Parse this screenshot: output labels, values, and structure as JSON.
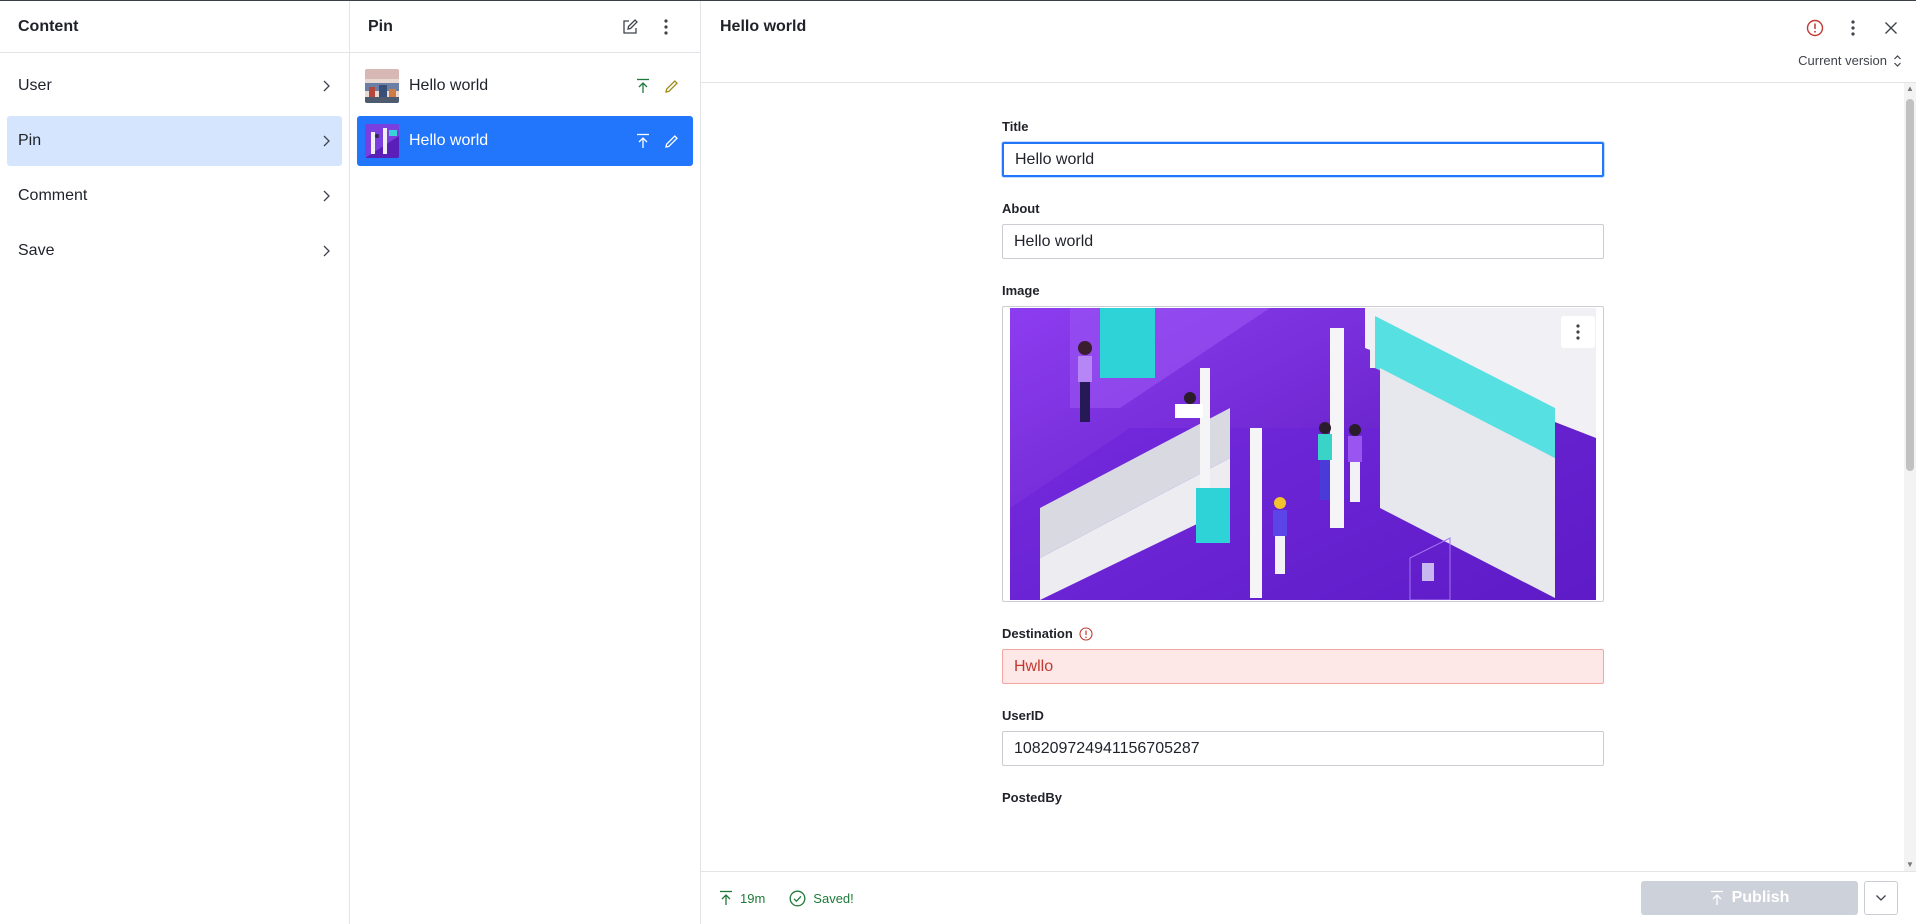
{
  "content_pane": {
    "title": "Content",
    "items": [
      {
        "label": "User"
      },
      {
        "label": "Pin"
      },
      {
        "label": "Comment"
      },
      {
        "label": "Save"
      }
    ]
  },
  "pin_pane": {
    "title": "Pin",
    "items": [
      {
        "label": "Hello world"
      },
      {
        "label": "Hello world"
      }
    ]
  },
  "editor": {
    "document_title": "Hello world",
    "version_label": "Current version",
    "fields": {
      "title": {
        "label": "Title",
        "value": "Hello world"
      },
      "about": {
        "label": "About",
        "value": "Hello world"
      },
      "image": {
        "label": "Image"
      },
      "destination": {
        "label": "Destination",
        "value": "Hwllo"
      },
      "userid": {
        "label": "UserID",
        "value": "108209724941156705287"
      },
      "postedby": {
        "label": "PostedBy"
      }
    }
  },
  "footer": {
    "published_ago": "19m",
    "save_status": "Saved!",
    "publish_label": "Publish"
  },
  "colors": {
    "accent": "#2276fc",
    "selected_soft": "#d5e5fd",
    "error": "#c1392f",
    "success": "#1e7a3a"
  }
}
